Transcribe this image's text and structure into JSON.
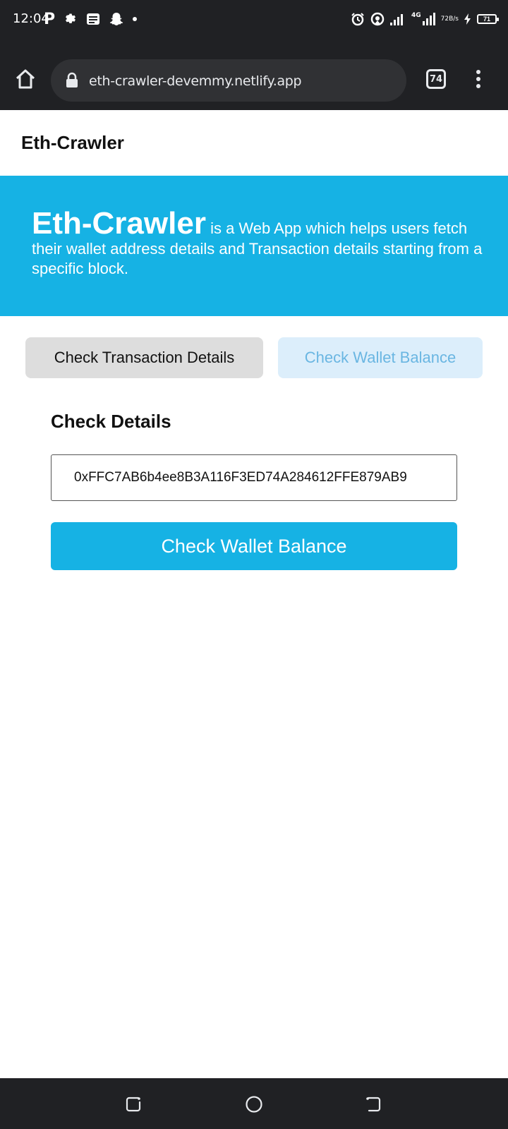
{
  "status_bar": {
    "time": "12:04",
    "left_icons": [
      "p-icon",
      "settings-icon",
      "news-icon",
      "snapchat-icon",
      "dot-icon"
    ],
    "network": "4G",
    "speed_value": "72",
    "speed_unit": "B/s",
    "battery": "71"
  },
  "browser": {
    "url": "eth-crawler-devemmy.netlify.app",
    "tab_count": "74"
  },
  "header": {
    "brand": "Eth-Crawler"
  },
  "hero": {
    "title": "Eth-Crawler",
    "description": " is a Web App which helps users fetch their wallet address details and Transaction details starting from a specific block."
  },
  "tabs": {
    "transactions_label": "Check Transaction Details",
    "wallet_label": "Check Wallet Balance"
  },
  "form": {
    "heading": "Check Details",
    "address_value": "0xFFC7AB6b4ee8B3A116F3ED74A284612FFE879AB9",
    "submit_label": "Check Wallet Balance"
  },
  "colors": {
    "accent": "#16b2e4",
    "inactive_tab_bg": "#dceefb",
    "inactive_tab_text": "#6ab6e2",
    "active_tab_bg": "#dddddd",
    "chrome_bg": "#202124"
  }
}
